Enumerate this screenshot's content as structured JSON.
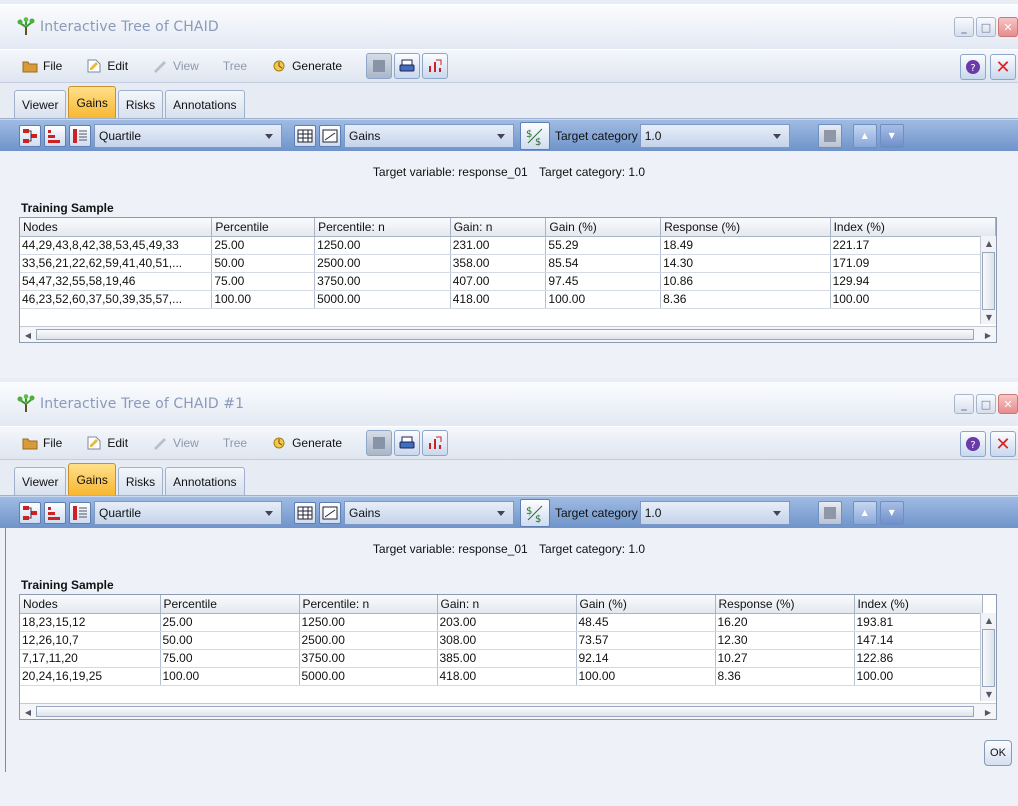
{
  "windows": [
    {
      "title": "Interactive Tree of CHAID",
      "menu": {
        "file": "File",
        "edit": "Edit",
        "view": "View",
        "tree": "Tree",
        "generate": "Generate"
      },
      "tabs": [
        "Viewer",
        "Gains",
        "Risks",
        "Annotations"
      ],
      "active_tab": "Gains",
      "toolbar": {
        "quantile": "Quartile",
        "display": "Gains",
        "target_category_label": "Target category",
        "target_category": "1.0"
      },
      "target_variable_text": "Target variable: response_01",
      "target_category_text": "Target category: 1.0",
      "section_title": "Training Sample",
      "columns": [
        "Nodes",
        "Percentile",
        "Percentile: n",
        "Gain: n",
        "Gain (%)",
        "Response (%)",
        "Index (%)"
      ],
      "rows": [
        [
          "44,29,43,8,42,38,53,45,49,33",
          "25.00",
          "1250.00",
          "231.00",
          "55.29",
          "18.49",
          "221.17"
        ],
        [
          "33,56,21,22,62,59,41,40,51,...",
          "50.00",
          "2500.00",
          "358.00",
          "85.54",
          "14.30",
          "171.09"
        ],
        [
          "54,47,32,55,58,19,46",
          "75.00",
          "3750.00",
          "407.00",
          "97.45",
          "10.86",
          "129.94"
        ],
        [
          "46,23,52,60,37,50,39,35,57,...",
          "100.00",
          "5000.00",
          "418.00",
          "100.00",
          "8.36",
          "100.00"
        ]
      ]
    },
    {
      "title": "Interactive Tree of CHAID #1",
      "menu": {
        "file": "File",
        "edit": "Edit",
        "view": "View",
        "tree": "Tree",
        "generate": "Generate"
      },
      "tabs": [
        "Viewer",
        "Gains",
        "Risks",
        "Annotations"
      ],
      "active_tab": "Gains",
      "toolbar": {
        "quantile": "Quartile",
        "display": "Gains",
        "target_category_label": "Target category",
        "target_category": "1.0"
      },
      "target_variable_text": "Target variable: response_01",
      "target_category_text": "Target category: 1.0",
      "section_title": "Training Sample",
      "columns": [
        "Nodes",
        "Percentile",
        "Percentile: n",
        "Gain: n",
        "Gain (%)",
        "Response (%)",
        "Index (%)"
      ],
      "rows": [
        [
          "18,23,15,12",
          "25.00",
          "1250.00",
          "203.00",
          "48.45",
          "16.20",
          "193.81"
        ],
        [
          "12,26,10,7",
          "50.00",
          "2500.00",
          "308.00",
          "73.57",
          "12.30",
          "147.14"
        ],
        [
          "7,17,11,20",
          "75.00",
          "3750.00",
          "385.00",
          "92.14",
          "10.27",
          "122.86"
        ],
        [
          "20,24,16,19,25",
          "100.00",
          "5000.00",
          "418.00",
          "100.00",
          "8.36",
          "100.00"
        ]
      ]
    }
  ],
  "ok_label": "OK",
  "colors": {
    "active_tab": "#f7b731",
    "toolbar_blue": "#7f9fd0",
    "close_red": "#d22222"
  }
}
